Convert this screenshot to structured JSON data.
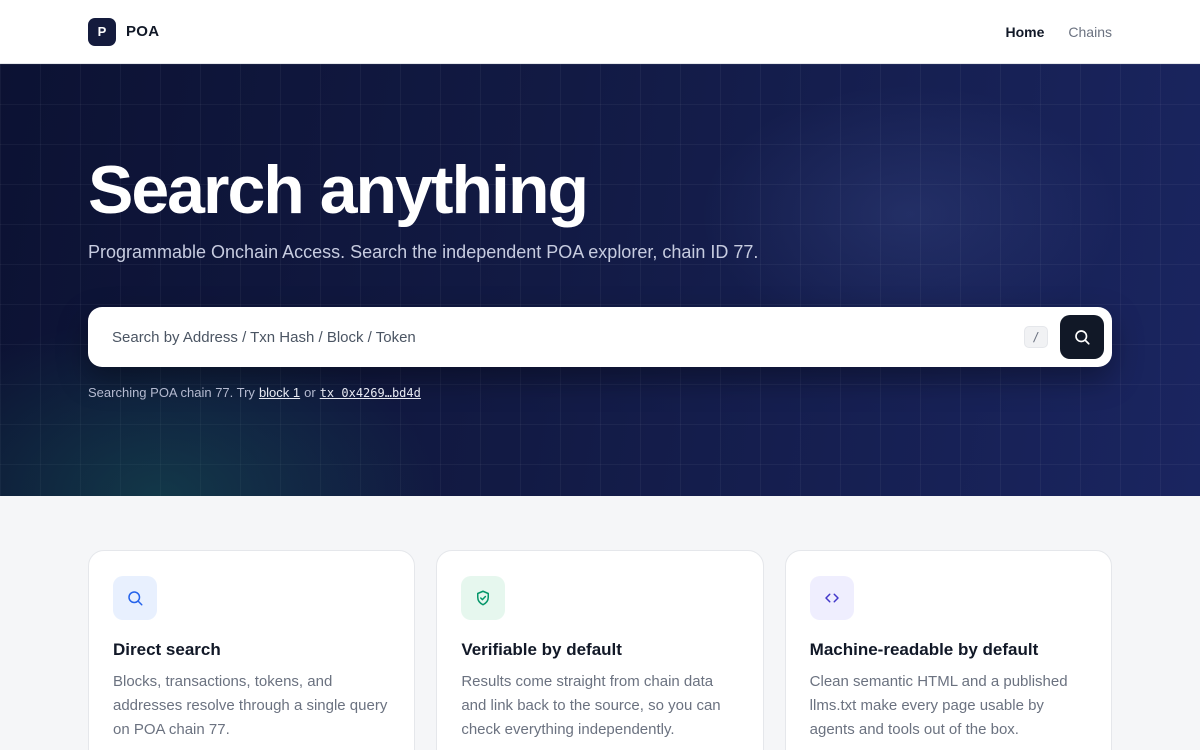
{
  "header": {
    "logo_letter": "P",
    "brand": "POA",
    "nav": [
      {
        "label": "Home",
        "active": true
      },
      {
        "label": "Chains",
        "active": false
      }
    ]
  },
  "hero": {
    "title": "Search anything",
    "subtitle": "Programmable Onchain Access. Search the independent POA explorer, chain ID 77.",
    "search": {
      "placeholder": "Search by Address / Txn Hash / Block / Token",
      "value": "",
      "shortcut": "/",
      "button_icon": "search-icon"
    },
    "hint": {
      "prefix": "Searching POA chain 77. Try",
      "link1": "block 1",
      "separator": "or",
      "link2": "tx 0x4269…bd4d"
    }
  },
  "features": [
    {
      "icon": "search-icon",
      "title": "Direct search",
      "body": "Blocks, transactions, tokens, and addresses resolve through a single query on POA chain 77."
    },
    {
      "icon": "shield-check-icon",
      "title": "Verifiable by default",
      "body": "Results come straight from chain data and link back to the source, so you can check everything independently."
    },
    {
      "icon": "code-icon",
      "title": "Machine-readable by default",
      "body": "Clean semantic HTML and a published llms.txt make every page usable by agents and tools out of the box."
    }
  ],
  "colors": {
    "hero_bg": "#121a44",
    "brand_mark": "#141b3d",
    "search_button": "#111827",
    "icon_blue": "#2563eb",
    "icon_green": "#059669",
    "icon_purple": "#4338ca"
  }
}
